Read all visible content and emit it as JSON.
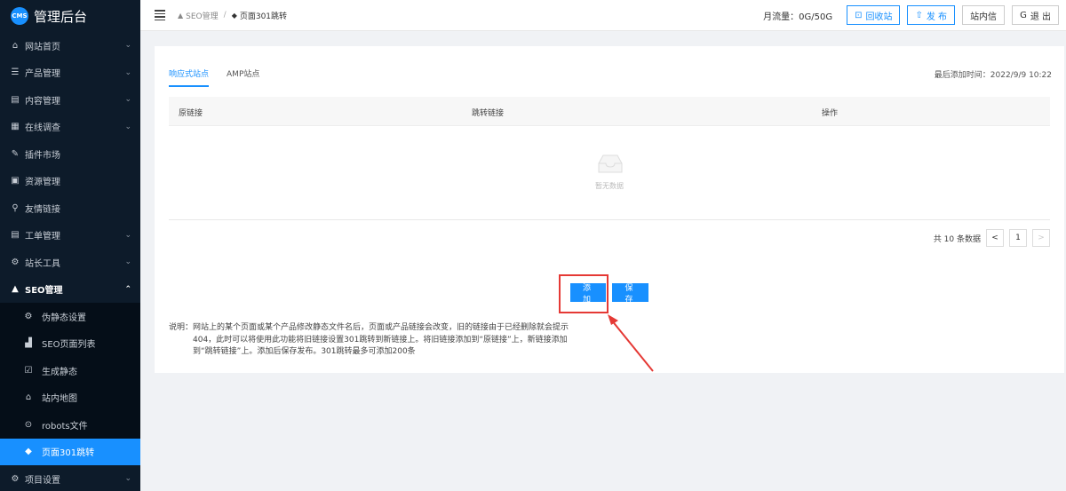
{
  "sidebar": {
    "brand_logo": "CMS",
    "brand_title": "管理后台",
    "items": [
      {
        "label": "网站首页",
        "icon": "home-icon",
        "glyph": "⌂",
        "chevron": "v"
      },
      {
        "label": "产品管理",
        "icon": "list-icon",
        "glyph": "☰",
        "chevron": "v"
      },
      {
        "label": "内容管理",
        "icon": "content-icon",
        "glyph": "▤",
        "chevron": "v"
      },
      {
        "label": "在线调查",
        "icon": "table-icon",
        "glyph": "▦",
        "chevron": "v"
      },
      {
        "label": "插件市场",
        "icon": "pin-icon",
        "glyph": "✎",
        "chevron": ""
      },
      {
        "label": "资源管理",
        "icon": "grid-icon",
        "glyph": "▣",
        "chevron": ""
      },
      {
        "label": "友情链接",
        "icon": "link-icon",
        "glyph": "⚲",
        "chevron": ""
      },
      {
        "label": "工单管理",
        "icon": "form-icon",
        "glyph": "▤",
        "chevron": "v"
      },
      {
        "label": "站长工具",
        "icon": "tools-icon",
        "glyph": "⚙",
        "chevron": "v"
      },
      {
        "label": "SEO管理",
        "icon": "warning-icon",
        "glyph": "▲",
        "chevron": "^"
      }
    ],
    "sub_items": [
      {
        "label": "伪静态设置",
        "icon": "gear-icon",
        "glyph": "⚙"
      },
      {
        "label": "SEO页面列表",
        "icon": "chart-icon",
        "glyph": "▟"
      },
      {
        "label": "生成静态",
        "icon": "checkbox-icon",
        "glyph": "☑"
      },
      {
        "label": "站内地图",
        "icon": "map-icon",
        "glyph": "⌂"
      },
      {
        "label": "robots文件",
        "icon": "robot-icon",
        "glyph": "⊙"
      },
      {
        "label": "页面301跳转",
        "icon": "tag-icon",
        "glyph": "◆"
      }
    ],
    "bottom_item": {
      "label": "项目设置",
      "icon": "settings-icon",
      "glyph": "⚙",
      "chevron": "v"
    }
  },
  "topbar": {
    "breadcrumb_root": "SEO管理",
    "breadcrumb_root_glyph": "▲",
    "breadcrumb_sep": "/",
    "breadcrumb_current": "页面301跳转",
    "breadcrumb_current_glyph": "◆",
    "traffic": "月流量：0G/50G",
    "recycle_label": "回收站",
    "recycle_glyph": "⊡",
    "publish_label": "发 布",
    "publish_glyph": "⇧",
    "messages_label": "站内信",
    "logout_label": "退 出",
    "logout_glyph": "G"
  },
  "main": {
    "tabs": [
      {
        "label": "响应式站点",
        "active": true
      },
      {
        "label": "AMP站点",
        "active": false
      }
    ],
    "last_added": "最后添加时间：2022/9/9 10:22",
    "table": {
      "columns": [
        "原链接",
        "跳转链接",
        "操作"
      ],
      "empty_text": "暂无数据"
    },
    "pagination": {
      "total_text": "共 10 条数据",
      "prev": "<",
      "page": "1",
      "next": ">"
    },
    "add_label": "添加",
    "save_label": "保存",
    "note": {
      "line1": "说明：网站上的某个页面或某个产品修改静态文件名后，页面或产品链接会改变，旧的链接由于已经删除就会提示",
      "line2": "404，此时可以将使用此功能将旧链接设置301跳转到新链接上。将旧链接添加到“原链接”上，新链接添加",
      "line3": "到“跳转链接”上。添加后保存发布。301跳转最多可添加200条"
    }
  },
  "colors": {
    "accent": "#1890ff",
    "sidebar_bg": "#0d1b2a",
    "highlight": "#e53935"
  }
}
